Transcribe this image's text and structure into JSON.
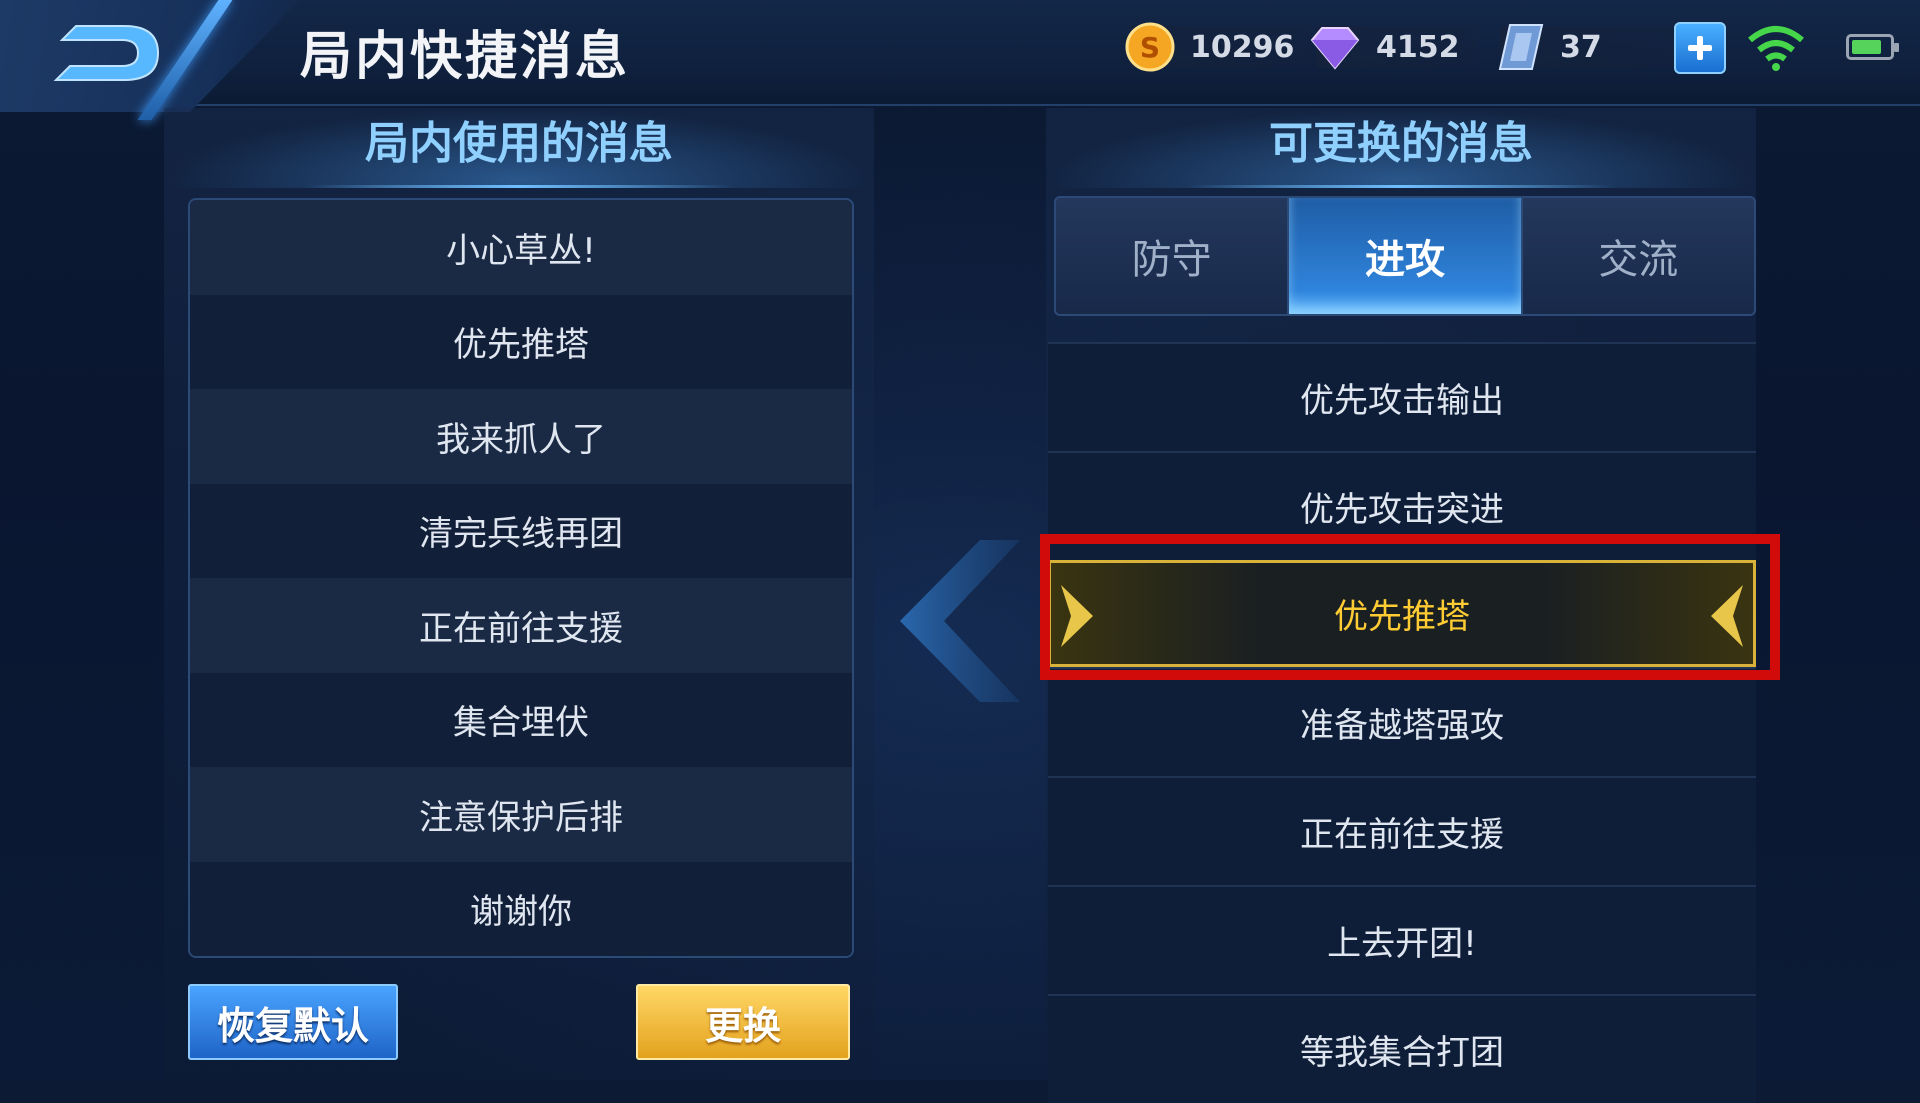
{
  "header": {
    "title": "局内快捷消息",
    "back_icon": "back-arrow-icon"
  },
  "resources": {
    "gold": "10296",
    "diamond": "4152",
    "coupon": "37"
  },
  "status": {
    "battery_level": 0.8
  },
  "left_panel": {
    "title": "局内使用的消息",
    "messages": [
      "小心草丛!",
      "优先推塔",
      "我来抓人了",
      "清完兵线再团",
      "正在前往支援",
      "集合埋伏",
      "注意保护后排",
      "谢谢你"
    ],
    "reset_label": "恢复默认",
    "replace_label": "更换"
  },
  "right_panel": {
    "title": "可更换的消息",
    "tabs": [
      {
        "label": "防守",
        "active": false
      },
      {
        "label": "进攻",
        "active": true
      },
      {
        "label": "交流",
        "active": false
      }
    ],
    "messages": [
      "优先攻击输出",
      "优先攻击突进",
      "优先推塔",
      "准备越塔强攻",
      "正在前往支援",
      "上去开团!",
      "等我集合打团"
    ],
    "selected_index": 2
  },
  "colors": {
    "accent_blue": "#2f84dc",
    "accent_gold": "#ffcc33",
    "highlight_red": "#d10a0a"
  }
}
